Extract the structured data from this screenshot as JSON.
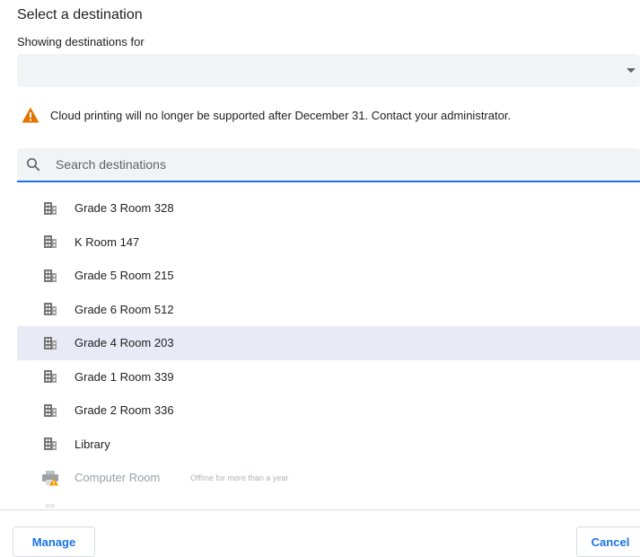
{
  "dialog": {
    "title": "Select a destination",
    "showing_label": "Showing destinations for",
    "account_value": ""
  },
  "warning": {
    "icon": "warning-icon",
    "color": "#e37400",
    "text": "Cloud printing will no longer be supported after December 31. Contact your administrator."
  },
  "search": {
    "icon": "search-icon",
    "placeholder": "Search destinations",
    "value": "",
    "accent_color": "#1a73e8"
  },
  "destinations": [
    {
      "name": "Grade 3 Room 328",
      "icon": "business-icon",
      "selected": false
    },
    {
      "name": "K Room 147",
      "icon": "business-icon",
      "selected": false
    },
    {
      "name": "Grade 5 Room 215",
      "icon": "business-icon",
      "selected": false
    },
    {
      "name": "Grade 6 Room 512",
      "icon": "business-icon",
      "selected": false
    },
    {
      "name": "Grade 4 Room 203",
      "icon": "business-icon",
      "selected": true
    },
    {
      "name": "Grade 1 Room 339",
      "icon": "business-icon",
      "selected": false
    },
    {
      "name": "Grade 2 Room 336",
      "icon": "business-icon",
      "selected": false
    },
    {
      "name": "Library",
      "icon": "business-icon",
      "selected": false
    },
    {
      "name": "Computer Room",
      "icon": "printer-offline-icon",
      "status": "Offline for more than a year",
      "offline": true
    }
  ],
  "buttons": {
    "manage": "Manage",
    "cancel": "Cancel"
  },
  "colors": {
    "accent": "#1a73e8",
    "selected_row": "#e8eaf5",
    "field_background": "#f1f3f4"
  }
}
